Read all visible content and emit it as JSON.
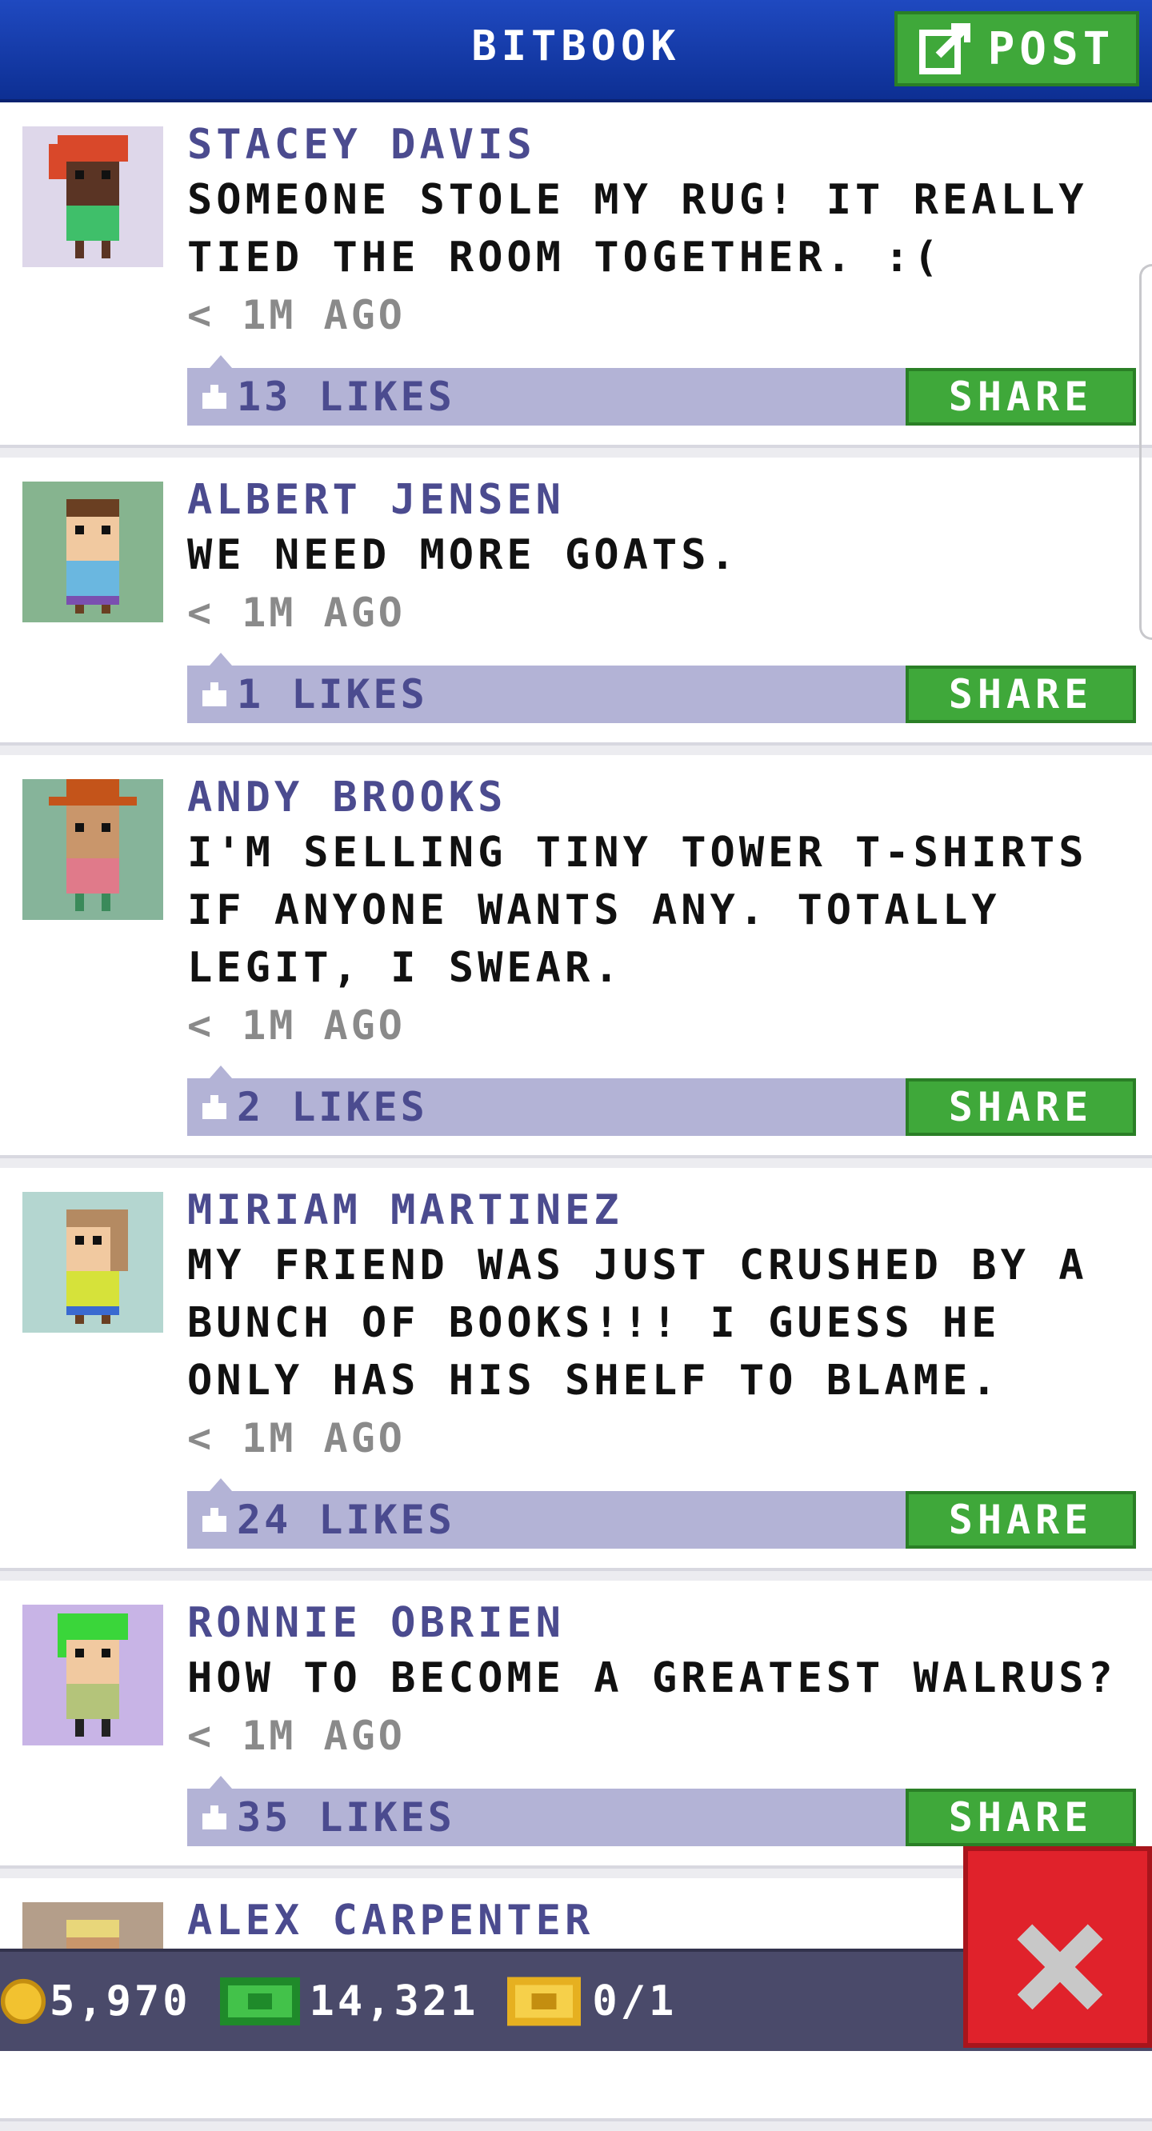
{
  "header": {
    "title": "BITBOOK",
    "post_label": "POST"
  },
  "posts": [
    {
      "author": "STACEY DAVIS",
      "message": "SOMEONE STOLE MY RUG! IT REALLY TIED THE ROOM TOGETHER. :(",
      "time": "< 1M AGO",
      "likes": "13 LIKES",
      "share_label": "SHARE",
      "avatar_bg": "#ded7ea"
    },
    {
      "author": "ALBERT JENSEN",
      "message": "WE NEED MORE GOATS.",
      "time": "< 1M AGO",
      "likes": "1 LIKES",
      "share_label": "SHARE",
      "avatar_bg": "#86b48f"
    },
    {
      "author": "ANDY BROOKS",
      "message": "I'M SELLING TINY TOWER T-SHIRTS IF ANYONE WANTS ANY. TOTALLY LEGIT, I SWEAR.",
      "time": "< 1M AGO",
      "likes": "2 LIKES",
      "share_label": "SHARE",
      "avatar_bg": "#86b49a"
    },
    {
      "author": "MIRIAM MARTINEZ",
      "message": "MY FRIEND WAS JUST CRUSHED BY A BUNCH OF BOOKS!!! I GUESS HE ONLY HAS HIS SHELF TO BLAME.",
      "time": "< 1M AGO",
      "likes": "24 LIKES",
      "share_label": "SHARE",
      "avatar_bg": "#b4d6d0"
    },
    {
      "author": "RONNIE OBRIEN",
      "message": "HOW TO BECOME A GREATEST WALRUS?",
      "time": "< 1M AGO",
      "likes": "35 LIKES",
      "share_label": "SHARE",
      "avatar_bg": "#c8b4e6"
    },
    {
      "author": "ALEX CARPENTER",
      "message": "",
      "time": "",
      "likes": "",
      "share_label": "",
      "avatar_bg": "#b49e8a"
    }
  ],
  "footer": {
    "coins": "5,970",
    "bux": "14,321",
    "tickets": "0/1"
  },
  "colors": {
    "header": "#1f49c0",
    "accent_green": "#3fa83a",
    "likes_bar": "#b3b3d6",
    "author_text": "#4b4b8f",
    "close_red": "#e0222b"
  }
}
